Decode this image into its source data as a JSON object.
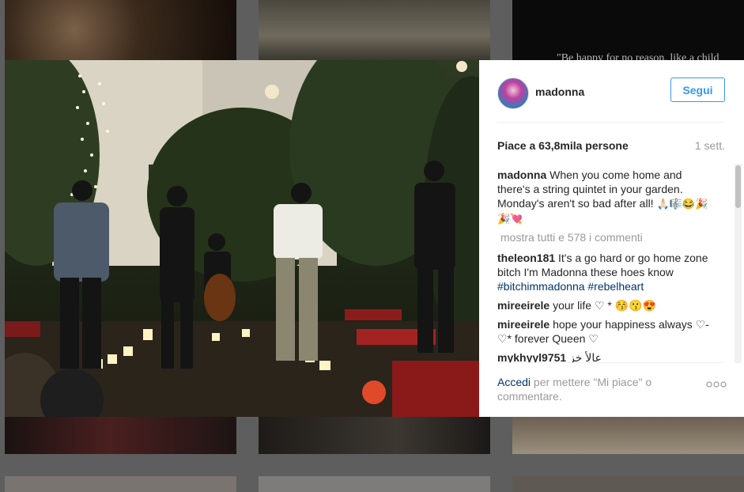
{
  "background": {
    "quote_text": "\"Be happy for no reason, like a child"
  },
  "post": {
    "username": "madonna",
    "follow_label": "Segui",
    "likes_text": "Piace a 63,8mila persone",
    "time_ago": "1 sett.",
    "caption": {
      "user": "madonna",
      "text": "When you come home and there's a string quintet in your garden. Monday's aren't so bad after all!",
      "emojis": "🙏🏻🎼😂🎉🎉💘"
    },
    "view_all_label": "mostra tutti e 578 i commenti",
    "comments": [
      {
        "user": "theleon181",
        "text": "It's a go hard or go home zone bitch I'm Madonna these hoes know",
        "tags": "#bitchimmadonna #rebelheart"
      },
      {
        "user": "mireeirele",
        "text": "your life ♡ * 😚😗😍"
      },
      {
        "user": "mireeirele",
        "text": "hope your happiness always ♡-♡* forever Queen ♡"
      },
      {
        "user": "mykhyyl9751",
        "text": "عالأ خز"
      }
    ],
    "footer": {
      "login_link": "Accedi",
      "login_rest": " per mettere \"Mi piace\" o commentare."
    }
  },
  "colors": {
    "accent": "#3897f0",
    "link": "#003569",
    "muted": "#999999"
  },
  "icons": {
    "more": "more-options-icon",
    "avatar": "madonna-avatar"
  }
}
